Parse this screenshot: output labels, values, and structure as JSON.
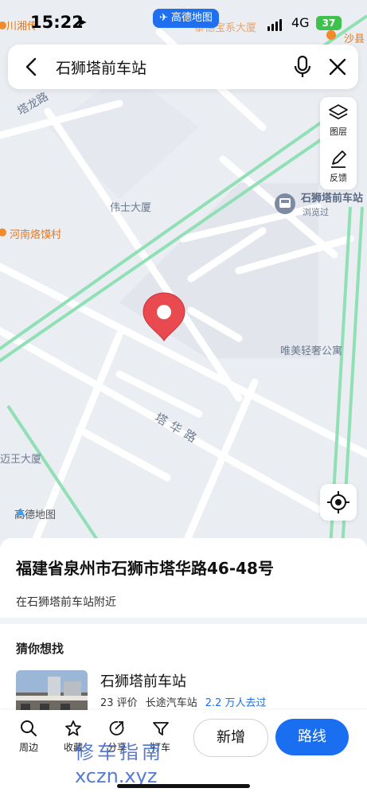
{
  "status_bar": {
    "back_app": "川湘传",
    "time": "15:22",
    "app_badge": "高德地图",
    "network": "4G",
    "battery": "37",
    "right_app": "沙县"
  },
  "search": {
    "query": "石狮塔前车站"
  },
  "map_tools": {
    "layers_label": "图层",
    "feedback_label": "反馈"
  },
  "map_labels": {
    "road_talong": "塔龙路",
    "road_tahua": "塔华路",
    "weishi": "伟士大厦",
    "henan": "河南烙馍村",
    "station_name": "石狮塔前车站",
    "station_visited": "浏览过",
    "weimei": "唯美轻奢公寓",
    "wanwang": "迈王大厦",
    "top_poi": "泰德宝系大厦",
    "logo": "高德地图"
  },
  "place": {
    "address": "福建省泉州市石狮市塔华路46-48号",
    "nearby": "在石狮塔前车站附近"
  },
  "recommend": {
    "header": "猜你想找",
    "items": [
      {
        "title": "石狮塔前车站",
        "reviews": "23 评价",
        "category": "长途汽车站",
        "visitors": "2.2 万人去过"
      }
    ]
  },
  "bottom_bar": {
    "nearby": "周边",
    "favorite": "收藏",
    "share": "分享",
    "taxi": "打车",
    "add": "新增",
    "route": "路线"
  },
  "watermark": {
    "line1": "修车指南",
    "line2": "xczn.xyz"
  },
  "colors": {
    "accent": "#1a6ef0",
    "pin": "#e84a4f",
    "road_green": "#8fe0b4"
  }
}
